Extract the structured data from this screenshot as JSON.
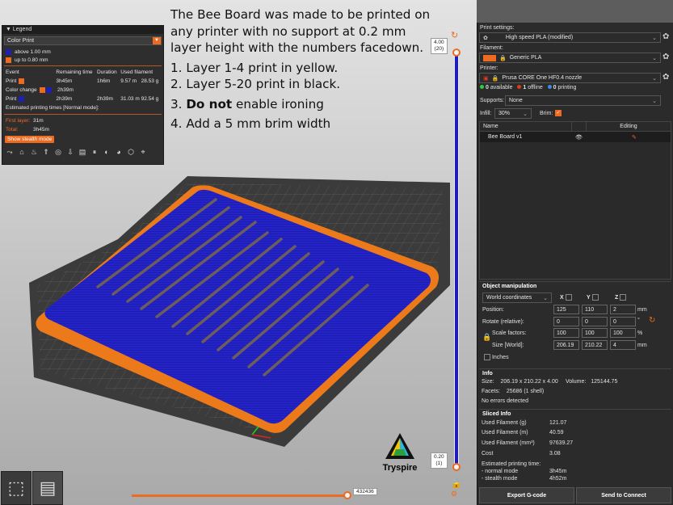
{
  "instructions": {
    "line1": "The Bee Board was made to be printed on any printer with no support at 0.2 mm layer height with the numbers facedown.",
    "line2": "1. Layer 1-4 print in yellow.",
    "line3": "2. Layer 5-20 print in black.",
    "line4_bold": "Do not",
    "line4_pre": "3. ",
    "line4_post": " enable ironing",
    "line5": "4. Add a 5 mm brim width"
  },
  "legend": {
    "title": "Legend",
    "mode": "Color Print",
    "ranges": [
      {
        "label": "above 1.00 mm",
        "color": "#1f1fb4"
      },
      {
        "label": "up to 0.80 mm",
        "color": "#ed6b21"
      }
    ],
    "columns": [
      "Event",
      "Remaining time",
      "Duration",
      "Used filament"
    ],
    "events": [
      {
        "name": "Print",
        "color": "#ed6b21",
        "color2": "",
        "remaining": "3h45m",
        "duration": "1h6m",
        "filament_m": "9.57 m",
        "filament_g": "28.53 g"
      },
      {
        "name": "Color change",
        "color": "#ed6b21",
        "color2": "#1f1fb4",
        "remaining": "2h39m",
        "duration": "",
        "filament_m": "",
        "filament_g": ""
      },
      {
        "name": "Print",
        "color": "#1f1fb4",
        "color2": "",
        "remaining": "2h39m",
        "duration": "2h39m",
        "filament_m": "31.03 m",
        "filament_g": "92.54 g"
      }
    ],
    "estimated_title": "Estimated printing times [Normal mode]:",
    "first_layer_label": "First layer:",
    "first_layer_value": "31m",
    "total_label": "Total:",
    "total_value": "3h45m",
    "stealth_button": "Show stealth mode"
  },
  "slider": {
    "top_value": "4.00",
    "top_layer": "(20)",
    "bottom_value": "0.20",
    "bottom_layer": "(1)",
    "horizontal_value": "432436"
  },
  "logo": {
    "text": "Tryspire"
  },
  "panel": {
    "print_settings_label": "Print settings:",
    "print_settings_value": "High speed PLA (modified)",
    "filament_label": "Filament:",
    "filament_value": "Generic PLA",
    "filament_color": "#ed6b21",
    "printer_label": "Printer:",
    "printer_value": "Prusa CORE One HF0.4 nozzle",
    "printer_status": [
      {
        "count": "0",
        "label": "available",
        "color": "#2ecc40"
      },
      {
        "count": "1",
        "label": "offline",
        "color": "#e03a1e"
      },
      {
        "count": "0",
        "label": "printing",
        "color": "#3d8be8"
      }
    ],
    "supports_label": "Supports:",
    "supports_value": "None",
    "infill_label": "Infill:",
    "infill_value": "30%",
    "brim_label": "Brim:",
    "object_list": {
      "col_name": "Name",
      "col_editing": "Editing",
      "items": [
        {
          "name": "Bee Board v1"
        }
      ]
    },
    "object_manipulation": {
      "title": "Object manipulation",
      "coords": "World coordinates",
      "axes": [
        "X",
        "Y",
        "Z"
      ],
      "position_label": "Position:",
      "position": [
        "125",
        "110",
        "2"
      ],
      "position_unit": "mm",
      "rotate_label": "Rotate (relative):",
      "rotate": [
        "0",
        "0",
        "0"
      ],
      "rotate_unit": "°",
      "scale_label": "Scale factors:",
      "scale": [
        "100",
        "100",
        "100"
      ],
      "scale_unit": "%",
      "size_label": "Size [World]:",
      "size": [
        "206.19",
        "210.22",
        "4"
      ],
      "size_unit": "mm",
      "inches_label": "Inches"
    },
    "info": {
      "title": "Info",
      "size_label": "Size:",
      "size_value": "206.19 x 210.22 x 4.00",
      "volume_label": "Volume:",
      "volume_value": "125144.75",
      "facets_label": "Facets:",
      "facets_value": "25686 (1 shell)",
      "errors": "No errors detected"
    },
    "sliced_info": {
      "title": "Sliced Info",
      "rows": [
        {
          "label": "Used Filament (g)",
          "value": "121.07"
        },
        {
          "label": "Used Filament (m)",
          "value": "40.59"
        },
        {
          "label": "Used Filament (mm³)",
          "value": "97639.27"
        },
        {
          "label": "Cost",
          "value": "3.08"
        }
      ],
      "est_label": "Estimated printing time:",
      "normal_label": "- normal mode",
      "normal_value": "3h45m",
      "stealth_label": "- stealth mode",
      "stealth_value": "4h52m"
    },
    "export_button": "Export G-code",
    "send_button": "Send to Connect"
  }
}
